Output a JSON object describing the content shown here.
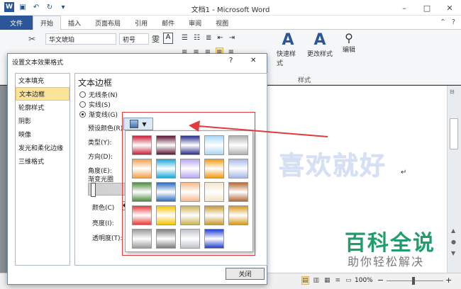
{
  "window": {
    "title": "文档1 - Microsoft Word",
    "minimize": "–",
    "maximize": "□",
    "close": "✕"
  },
  "qat": {
    "save_icon": "save-icon",
    "undo_icon": "undo-icon",
    "redo_icon": "redo-icon"
  },
  "tabs": [
    "文件",
    "开始",
    "插入",
    "页面布局",
    "引用",
    "邮件",
    "审阅",
    "视图"
  ],
  "ribbon": {
    "font_name": "华文琥珀",
    "font_size": "初号",
    "styles_group_label": "样式",
    "quick_styles_label": "快速样式",
    "change_styles_label": "更改样式",
    "edit_label": "编辑"
  },
  "dialog": {
    "title": "设置文本效果格式",
    "help": "?",
    "close_x": "✕",
    "nav_items": [
      "文本填充",
      "文本边框",
      "轮廓样式",
      "阴影",
      "映像",
      "发光和柔化边缘",
      "三维格式"
    ],
    "selected_nav": 1,
    "panel_heading": "文本边框",
    "options": {
      "no_line": "无线条(N)",
      "solid_line": "实线(S)",
      "gradient_line": "渐变线(G)"
    },
    "labels": {
      "preset": "预设颜色(R):",
      "type": "类型(Y):",
      "direction": "方向(D):",
      "angle": "角度(E):",
      "gradient_stops": "渐变光圈",
      "color": "颜色(C)",
      "brightness": "亮度(I):",
      "transparency": "透明度(T):"
    },
    "close_button": "关闭"
  },
  "swatch_colors": [
    [
      "#c9203a",
      "#5a1530",
      "#2a2f8a",
      "#a8d6f7",
      "#b0b0b0"
    ],
    [
      "#f3a04a",
      "#1aa8d8",
      "#b6a6f0",
      "#f29a10",
      "#a7b7e8"
    ],
    [
      "#4e8c3e",
      "#2b6bbd",
      "#f6b98c",
      "#f1e6c9",
      "#b56a35"
    ],
    [
      "#e83a3a",
      "#f5c400",
      "#c9b352",
      "#c79a2e",
      "#d69a1a"
    ],
    [
      "#9a9a9a",
      "#7d7d7d",
      "#bfc3c9",
      "#1f3fd0",
      ""
    ]
  ],
  "watermarks": {
    "main": "喜欢就好",
    "brand": "百科全说",
    "sub": "助你轻松解决"
  },
  "status": {
    "zoom": "100%",
    "zoom_out": "−",
    "zoom_in": "+"
  }
}
